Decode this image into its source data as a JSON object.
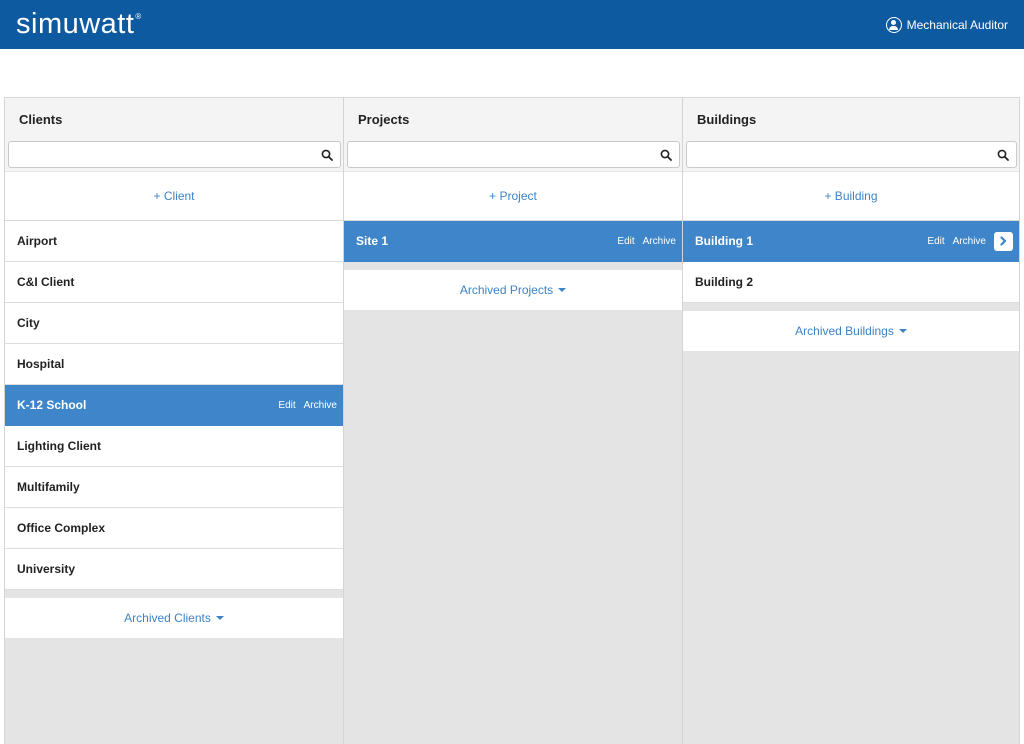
{
  "header": {
    "logo": "simuwatt",
    "logo_mark": "®",
    "user": "Mechanical Auditor",
    "icons": {
      "user": "user-circle-icon",
      "search": "search-icon",
      "chevron": "chevron-right-icon"
    },
    "colors": {
      "brand": "#0e5aa0",
      "selected": "#3e86c9",
      "link": "#3c84c7"
    }
  },
  "clients": {
    "title": "Clients",
    "search_placeholder": "",
    "add_label": "+ Client",
    "items": [
      {
        "label": "Airport"
      },
      {
        "label": "C&I Client"
      },
      {
        "label": "City"
      },
      {
        "label": "Hospital"
      },
      {
        "label": "K-12 School",
        "edit": "Edit",
        "archive": "Archive"
      },
      {
        "label": "Lighting Client"
      },
      {
        "label": "Multifamily"
      },
      {
        "label": "Office Complex"
      },
      {
        "label": "University"
      }
    ],
    "archived_label": "Archived Clients"
  },
  "projects": {
    "title": "Projects",
    "search_placeholder": "",
    "add_label": "+ Project",
    "items": [
      {
        "label": "Site 1",
        "edit": "Edit",
        "archive": "Archive"
      }
    ],
    "archived_label": "Archived Projects"
  },
  "buildings": {
    "title": "Buildings",
    "search_placeholder": "",
    "add_label": "+ Building",
    "items": [
      {
        "label": "Building 1",
        "edit": "Edit",
        "archive": "Archive"
      },
      {
        "label": "Building 2"
      }
    ],
    "archived_label": "Archived Buildings"
  }
}
